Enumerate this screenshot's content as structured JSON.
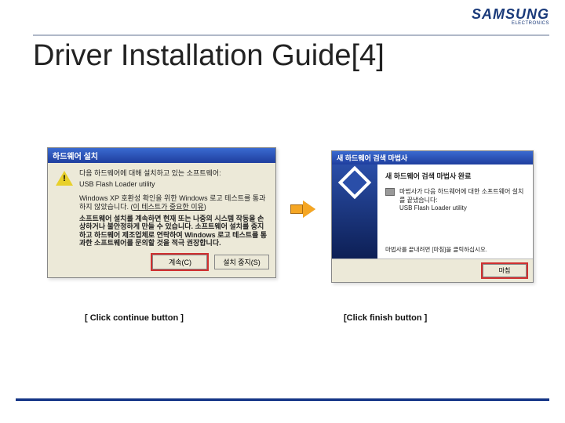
{
  "logo": {
    "brand": "SAMSUNG",
    "sub": "ELECTRONICS"
  },
  "title": "Driver Installation Guide[4]",
  "dlg1": {
    "title": "하드웨어 설치",
    "line1": "다음 하드웨어에 대해 설치하고 있는 소프트웨어:",
    "usb": "USB Flash Loader utility",
    "compat_prefix": "Windows XP 호환성 확인을 위한 Windows 로고 테스트를 통과하지 않았습니다. (",
    "compat_link": "이 테스트가 중요한 이유",
    "compat_suffix": ")",
    "bold": "소프트웨어 설치를 계속하면 현재 또는 나중의 시스템 작동을 손상하거나 불안정하게 만들 수 있습니다. 소프트웨어 설치를 중지하고 하드웨어 제조업체로 연락하여 Windows 로고 테스트를 통과한 소프트웨어를 문의할 것을 적극 권장합니다.",
    "btn_continue": "계속(C)",
    "btn_stop": "설치 중지(S)"
  },
  "dlg2": {
    "title": "새 하드웨어 검색 마법사",
    "heading": "새 하드웨어 검색 마법사 완료",
    "line1": "마법사가 다음 하드웨어에 대한 소프트웨어 설치를 끝냈습니다:",
    "usb": "USB Flash Loader utility",
    "foot": "마법사를 끝내려면 [마침]을 클릭하십시오.",
    "btn_finish": "마침"
  },
  "captions": {
    "left": "[ Click continue button ]",
    "right": "[Click finish button ]"
  }
}
